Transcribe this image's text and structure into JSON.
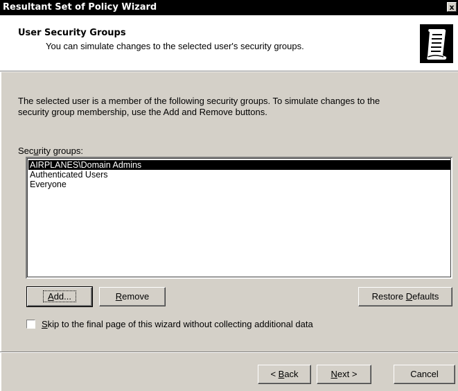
{
  "window": {
    "title": "Resultant Set of Policy Wizard",
    "close_glyph": "x"
  },
  "header": {
    "title": "User Security Groups",
    "subtitle": "You can simulate changes to the selected user's security groups.",
    "icon": "scroll-document-icon"
  },
  "body": {
    "intro_line1": "The selected user is a member of the following security groups. To simulate changes to the",
    "intro_line2": "security group membership, use the Add and Remove buttons.",
    "groups_label_pre": "Sec",
    "groups_label_accel": "u",
    "groups_label_post": "rity groups:",
    "groups": [
      {
        "label": "AIRPLANES\\Domain Admins",
        "selected": true
      },
      {
        "label": "Authenticated Users",
        "selected": false
      },
      {
        "label": "Everyone",
        "selected": false
      }
    ]
  },
  "buttons": {
    "add_accel": "A",
    "add_rest": "dd...",
    "remove_accel": "R",
    "remove_rest": "emove",
    "restore_pre": "Restore ",
    "restore_accel": "D",
    "restore_rest": "efaults"
  },
  "skip_checkbox": {
    "accel": "S",
    "rest": "kip to the final page of this wizard without collecting additional data",
    "checked": false
  },
  "footer": {
    "back_pre": "< ",
    "back_accel": "B",
    "back_rest": "ack",
    "next_accel": "N",
    "next_rest": "ext >",
    "cancel": "Cancel"
  },
  "colors": {
    "dialog_bg": "#d4d0c8",
    "titlebar_bg": "#000000",
    "selection_bg": "#000000"
  }
}
